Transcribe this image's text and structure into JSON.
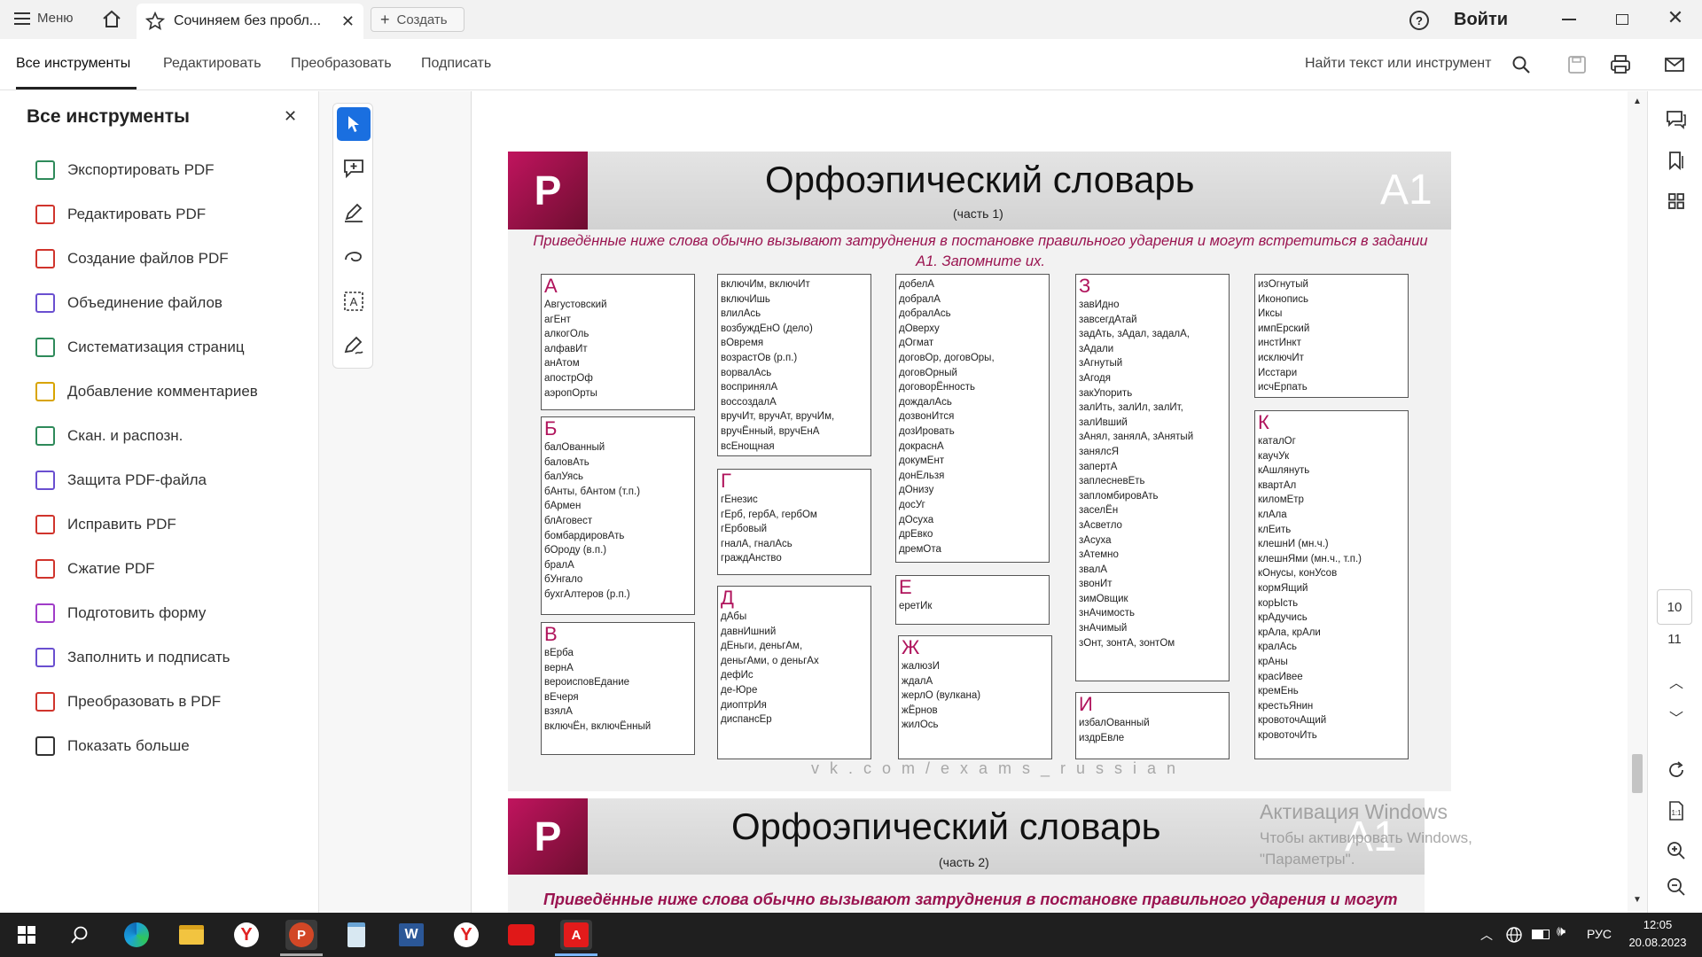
{
  "titlebar": {
    "menu_label": "Меню",
    "tab_title": "Сочиняем без пробл...",
    "create_label": "Создать",
    "signin_label": "Войти"
  },
  "toolbar": {
    "tabs": [
      "Все инструменты",
      "Редактировать",
      "Преобразовать",
      "Подписать"
    ],
    "search_label": "Найти текст или инструмент"
  },
  "sidepanel": {
    "title": "Все инструменты",
    "items": [
      {
        "label": "Экспортировать PDF",
        "icon": "export-pdf-icon",
        "color": "#2e8a5a"
      },
      {
        "label": "Редактировать PDF",
        "icon": "edit-pdf-icon",
        "color": "#d0342c"
      },
      {
        "label": "Создание файлов PDF",
        "icon": "create-pdf-icon",
        "color": "#d0342c"
      },
      {
        "label": "Объединение файлов",
        "icon": "combine-files-icon",
        "color": "#6a4fd0"
      },
      {
        "label": "Систематизация страниц",
        "icon": "organize-pages-icon",
        "color": "#2e8a5a"
      },
      {
        "label": "Добавление комментариев",
        "icon": "comment-icon",
        "color": "#d8a400"
      },
      {
        "label": "Скан. и распозн.",
        "icon": "scan-ocr-icon",
        "color": "#2e8a5a"
      },
      {
        "label": "Защита PDF-файла",
        "icon": "protect-pdf-icon",
        "color": "#6a4fd0"
      },
      {
        "label": "Исправить PDF",
        "icon": "redact-pdf-icon",
        "color": "#d0342c"
      },
      {
        "label": "Сжатие PDF",
        "icon": "compress-pdf-icon",
        "color": "#d0342c"
      },
      {
        "label": "Подготовить форму",
        "icon": "prepare-form-icon",
        "color": "#a03cc8"
      },
      {
        "label": "Заполнить и подписать",
        "icon": "fill-sign-icon",
        "color": "#6a4fd0"
      },
      {
        "label": "Преобразовать в PDF",
        "icon": "convert-to-pdf-icon",
        "color": "#d0342c"
      },
      {
        "label": "Показать больше",
        "icon": "more-tools-icon",
        "color": "#333333"
      }
    ]
  },
  "doc": {
    "logo_letter": "P",
    "title": "Орфоэпический словарь",
    "part1": "(часть 1)",
    "badge": "А1",
    "intro": "Приведённые ниже слова обычно вызывают затруднения в постановке правильного ударения и могут встретиться в задании А1. Запомните их.",
    "footer_link": "vk.com/exams_russian",
    "title2": "Орфоэпический словарь",
    "part2": "(часть 2)",
    "intro2": "Приведённые ниже слова обычно вызывают затруднения в постановке правильного ударения и могут",
    "cards": [
      {
        "letter": "А",
        "words": [
          "Августовский",
          "агЕнт",
          "алкогОль",
          "алфавИт",
          "анАтом",
          "апострОф",
          "аэропОрты"
        ]
      },
      {
        "letter": "Б",
        "words": [
          "балОванный",
          "баловАть",
          "балУясь",
          "бАнты, бАнтом (т.п.)",
          "бАрмен",
          "блАговест",
          "бомбардировАть",
          "бОроду (в.п.)",
          "бралА",
          "бУнгало",
          "бухгАлтеров (р.п.)"
        ]
      },
      {
        "letter": "В",
        "words": [
          "вЕрба",
          "вернА",
          "вероисповЕдание",
          "вЕчеря",
          "взялА",
          "включЁн, включЁнный"
        ]
      },
      {
        "letter": "",
        "words": [
          "включИм, включИт",
          "включИшь",
          "влилАсь",
          "возбуждЕнО (дело)",
          "вОвремя",
          "возрастОв (р.п.)",
          "ворвалАсь",
          "воспринялА",
          "воссоздалА",
          "вручИт, вручАт, вручИм,",
          "вручЁнный, вручЕнА",
          "всЕнощная"
        ]
      },
      {
        "letter": "Г",
        "words": [
          "гЕнезис",
          "гЕрб, гербА, гербОм",
          "гЕрбовый",
          "гналА, гналАсь",
          "граждАнство"
        ]
      },
      {
        "letter": "Д",
        "words": [
          "дАбы",
          "давнИшний",
          "дЕньги, деньгАм,",
          "деньгАми, о деньгАх",
          "дефИс",
          "де-Юре",
          "диоптрИя",
          "диспансЕр"
        ]
      },
      {
        "letter": "",
        "words": [
          "добелА",
          "добралА",
          "добралАсь",
          "дОверху",
          "дОгмат",
          "договОр, договОры,",
          "договОрный",
          "договорЁнность",
          "дождалАсь",
          "дозвонИтся",
          "дозИровать",
          "докраснА",
          "докумЕнт",
          "донЕльзя",
          "дОнизу",
          "досУг",
          "дОсуха",
          "дрЕвко",
          "дремОта"
        ]
      },
      {
        "letter": "Е",
        "words": [
          "еретИк"
        ]
      },
      {
        "letter": "Ж",
        "words": [
          "жалюзИ",
          "ждалА",
          "жерлО (вулкана)",
          "жЁрнов",
          "жилОсь"
        ]
      },
      {
        "letter": "З",
        "words": [
          "завИдно",
          "завсегдАтай",
          "задАть, зАдал, задалА,",
          "зАдали",
          "зАгнутый",
          "зАгодя",
          "закУпорить",
          "залИть, залИл, залИт,",
          "залИвший",
          "зАнял, занялА, зАнятый",
          "занялсЯ",
          "запертА",
          "заплесневЕть",
          "запломбировАть",
          "заселЁн",
          "зАсветло",
          "зАсуха",
          "зАтемно",
          "звалА",
          "звонИт",
          "зимОвщик",
          "знАчимость",
          "знАчимый",
          "зОнт, зонтА, зонтОм"
        ]
      },
      {
        "letter": "И",
        "words": [
          "избалОванный",
          "издрЕвле"
        ]
      },
      {
        "letter": "",
        "words": [
          "изОгнутый",
          "Иконопись",
          "Иксы",
          "импЕрский",
          "инстИнкт",
          "исключИт",
          "Исстари",
          "исчЕрпать"
        ]
      },
      {
        "letter": "К",
        "words": [
          "каталОг",
          "каучУк",
          "кАшлянуть",
          "квартАл",
          "киломЕтр",
          "клАла",
          "клЕить",
          "клешнИ (мн.ч.)",
          "клешнЯми (мн.ч., т.п.)",
          "кОнусы, конУсов",
          "кормЯщий",
          "корЫсть",
          "крАдучись",
          "крАла, крАли",
          "кралАсь",
          "крАны",
          "красИвее",
          "кремЕнь",
          "крестьЯнин",
          "кровоточАщий",
          "кровоточИть"
        ]
      }
    ]
  },
  "watermark": {
    "title": "Активация Windows",
    "subtitle": "Чтобы активировать Windows, перейдите в раздел \"Параметры\"."
  },
  "rightbar": {
    "page_current": "10",
    "page_next": "11"
  },
  "taskbar": {
    "lang": "РУС",
    "time": "12:05",
    "date": "20.08.2023"
  }
}
